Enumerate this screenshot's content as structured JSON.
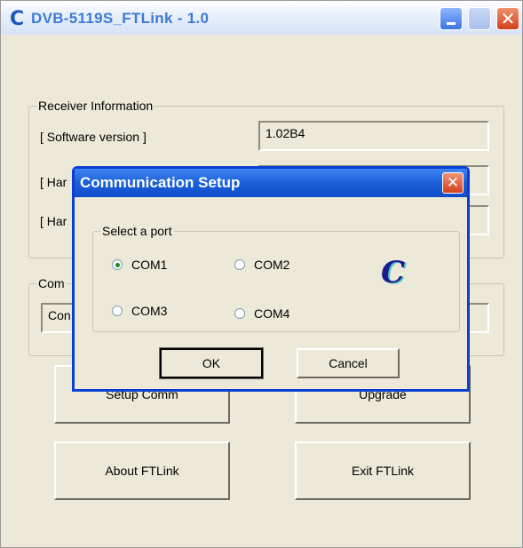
{
  "window": {
    "title": "DVB-5119S_FTLink - 1.0",
    "icon": "C"
  },
  "receiver_info": {
    "legend": "Receiver Information",
    "software_label": "[ Software version ]",
    "software_value": "1.02B4",
    "hardware1_label_partial": "[ Har",
    "hardware2_label_partial": "[ Har"
  },
  "comm_group": {
    "legend_partial": "Com",
    "field_partial": "Con"
  },
  "buttons": {
    "setup_comm": "Setup Comm",
    "upgrade": "Upgrade",
    "about": "About FTLink",
    "exit": "Exit FTLink"
  },
  "dialog": {
    "title": "Communication Setup",
    "group_legend": "Select a port",
    "ports": [
      {
        "label": "COM1",
        "selected": true
      },
      {
        "label": "COM2",
        "selected": false
      },
      {
        "label": "COM3",
        "selected": false
      },
      {
        "label": "COM4",
        "selected": false
      }
    ],
    "ok_label": "OK",
    "cancel_label": "Cancel"
  },
  "colors": {
    "dialog_title": "#1c5fd9",
    "window_bg": "#ece9d8",
    "title_text": "#3f7ad8"
  }
}
